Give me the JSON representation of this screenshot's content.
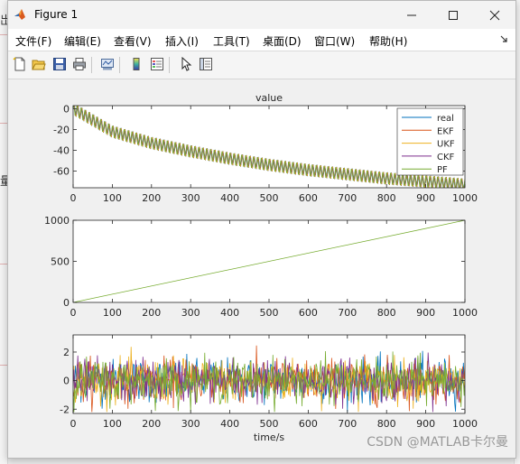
{
  "window": {
    "title": "Figure 1"
  },
  "window_controls": {
    "minimize": "—",
    "maximize": "☐",
    "close": "✕"
  },
  "menubar": {
    "items": [
      "文件(F)",
      "编辑(E)",
      "查看(V)",
      "插入(I)",
      "工具(T)",
      "桌面(D)",
      "窗口(W)",
      "帮助(H)"
    ],
    "overflow_icon": "menu-overflow-arrow-icon"
  },
  "toolbar": {
    "buttons": [
      "new-figure-icon",
      "open-file-icon",
      "save-icon",
      "print-icon",
      "link-plot-icon",
      "insert-colorbar-icon",
      "insert-legend-icon",
      "pointer-icon",
      "property-inspector-icon"
    ]
  },
  "background": {
    "glyphs": [
      "岀",
      "量"
    ]
  },
  "chart_data": [
    {
      "type": "line",
      "title": "value",
      "xlabel": "",
      "ylabel": "",
      "xlim": [
        0,
        1000
      ],
      "ylim": [
        -76,
        3
      ],
      "xticks": [
        0,
        100,
        200,
        300,
        400,
        500,
        600,
        700,
        800,
        900,
        1000
      ],
      "yticks": [
        0,
        -20,
        -40,
        -60
      ],
      "legend": {
        "placement": "top-right",
        "entries": [
          "real",
          "EKF",
          "UKF",
          "CKF",
          "PF"
        ]
      },
      "series": [
        {
          "name": "real",
          "color": "#0072BD",
          "description_trend": "oscillating, decreasing",
          "x": [
            0,
            100,
            200,
            300,
            400,
            500,
            600,
            700,
            800,
            900,
            1000
          ],
          "y": [
            0,
            -22,
            -33,
            -41,
            -48,
            -54,
            -59,
            -63,
            -67,
            -70,
            -73
          ]
        },
        {
          "name": "EKF",
          "color": "#D95319",
          "x": [
            0,
            100,
            200,
            300,
            400,
            500,
            600,
            700,
            800,
            900,
            1000
          ],
          "y": [
            0,
            -22,
            -33,
            -41,
            -48,
            -54,
            -59,
            -63,
            -67,
            -70,
            -73
          ]
        },
        {
          "name": "UKF",
          "color": "#EDB120",
          "x": [
            0,
            100,
            200,
            300,
            400,
            500,
            600,
            700,
            800,
            900,
            1000
          ],
          "y": [
            0,
            -22,
            -33,
            -41,
            -48,
            -54,
            -59,
            -63,
            -67,
            -70,
            -73
          ]
        },
        {
          "name": "CKF",
          "color": "#7E2F8E",
          "x": [
            0,
            100,
            200,
            300,
            400,
            500,
            600,
            700,
            800,
            900,
            1000
          ],
          "y": [
            0,
            -22,
            -33,
            -41,
            -48,
            -54,
            -59,
            -63,
            -67,
            -70,
            -73
          ]
        },
        {
          "name": "PF",
          "color": "#77AC30",
          "x": [
            0,
            100,
            200,
            300,
            400,
            500,
            600,
            700,
            800,
            900,
            1000
          ],
          "y": [
            0,
            -22,
            -33,
            -41,
            -48,
            -54,
            -59,
            -63,
            -67,
            -70,
            -73
          ]
        }
      ]
    },
    {
      "type": "line",
      "title": "",
      "xlabel": "",
      "ylabel": "",
      "xlim": [
        0,
        1000
      ],
      "ylim": [
        0,
        1000
      ],
      "xticks": [
        0,
        100,
        200,
        300,
        400,
        500,
        600,
        700,
        800,
        900,
        1000
      ],
      "yticks": [
        0,
        500,
        1000
      ],
      "series": [
        {
          "color": "#77AC30",
          "x": [
            0,
            1000
          ],
          "y": [
            0,
            1000
          ]
        }
      ]
    },
    {
      "type": "line",
      "title": "",
      "xlabel": "time/s",
      "ylabel": "",
      "xlim": [
        0,
        1000
      ],
      "ylim": [
        -2.3,
        3.2
      ],
      "xticks": [
        0,
        100,
        200,
        300,
        400,
        500,
        600,
        700,
        800,
        900,
        1000
      ],
      "yticks": [
        2,
        0,
        -2
      ],
      "series": [
        {
          "color": "#0072BD",
          "description_noise_range": [
            -2.2,
            3.0
          ]
        },
        {
          "color": "#D95319"
        },
        {
          "color": "#EDB120"
        },
        {
          "color": "#7E2F8E"
        },
        {
          "color": "#77AC30"
        }
      ]
    }
  ],
  "watermark": "CSDN @MATLAB卡尔曼"
}
